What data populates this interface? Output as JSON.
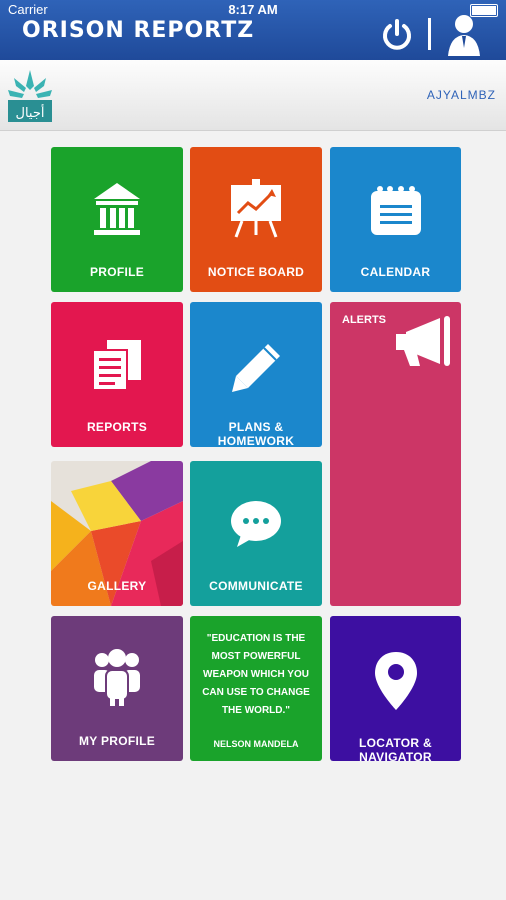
{
  "status": {
    "carrier": "Carrier",
    "time": "8:17 AM"
  },
  "header": {
    "brand": "ORISON REPORTZ"
  },
  "subheader": {
    "username": "AJYALMBZ"
  },
  "tiles": {
    "profile": {
      "label": "PROFILE",
      "color": "#1aa32b"
    },
    "notice": {
      "label": "NOTICE BOARD",
      "color": "#e24d14"
    },
    "calendar": {
      "label": "CALENDAR",
      "color": "#1b87cc"
    },
    "reports": {
      "label": "REPORTS",
      "color": "#e3174f"
    },
    "plans": {
      "label": "PLANS & HOMEWORK",
      "color": "#1b87cc"
    },
    "alerts": {
      "label": "ALERTS",
      "color": "#cc3666"
    },
    "gallery": {
      "label": "GALLERY"
    },
    "communicate": {
      "label": "COMMUNICATE",
      "color": "#14a09c"
    },
    "myprofile": {
      "label": "MY PROFILE",
      "color": "#6d3b7a"
    },
    "quote": {
      "text": "\"EDUCATION IS THE MOST POWERFUL WEAPON WHICH YOU CAN USE TO CHANGE THE WORLD.\"",
      "author": "NELSON MANDELA",
      "color": "#1aa32b"
    },
    "locator": {
      "label": "LOCATOR & NAVIGATOR",
      "color": "#3d0fa1"
    }
  }
}
